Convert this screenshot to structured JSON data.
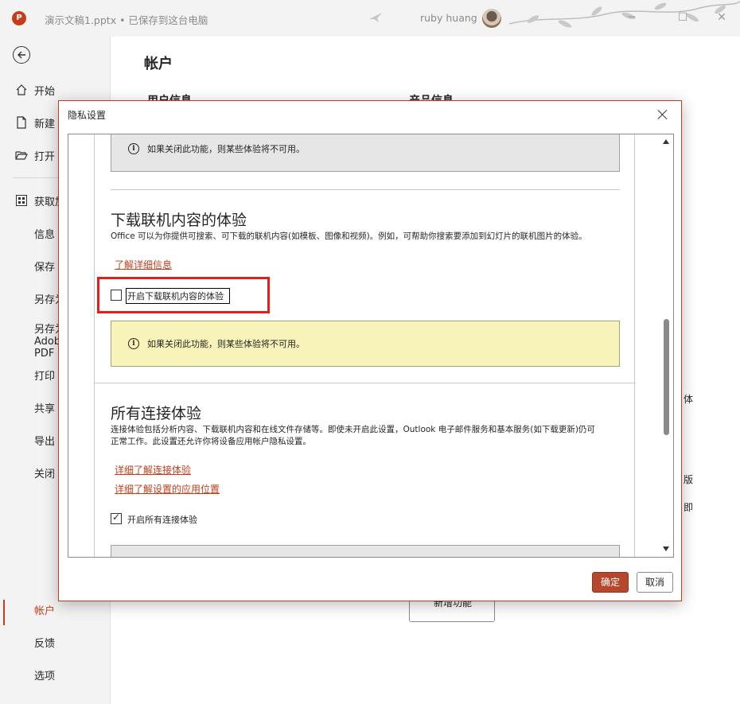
{
  "titlebar": {
    "app_logo": "P",
    "document_title": "演示文稿1.pptx • 已保存到这台电脑",
    "user_name": "ruby huang",
    "minimize": "─",
    "restore": "☐",
    "close": "✕"
  },
  "sidebar": {
    "items": [
      {
        "label": "开始",
        "icon": "home-icon"
      },
      {
        "label": "新建",
        "icon": "new-document-icon"
      },
      {
        "label": "打开",
        "icon": "open-folder-icon"
      },
      {
        "label": "获取加载项",
        "icon": "addins-icon"
      },
      {
        "label": "信息"
      },
      {
        "label": "保存"
      },
      {
        "label": "另存为"
      },
      {
        "label": "另存为 Adobe PDF"
      },
      {
        "label": "打印"
      },
      {
        "label": "共享"
      },
      {
        "label": "导出"
      },
      {
        "label": "关闭"
      },
      {
        "label": "帐户",
        "active": true
      },
      {
        "label": "反馈"
      },
      {
        "label": "选项"
      }
    ]
  },
  "account_page": {
    "title": "帐户",
    "user_info_heading": "用户信息",
    "product_info_heading": "产品信息",
    "right_fragments": [
      "体",
      "版",
      "即"
    ],
    "whats_new_button": "新增功能"
  },
  "dialog": {
    "title": "隐私设置",
    "top_info_text": "如果关闭此功能，则某些体验将不可用。",
    "download_section": {
      "heading": "下载联机内容的体验",
      "description": "Office 可以为你提供可搜索、可下载的联机内容(如模板、图像和视频)。例如，可帮助你搜索要添加到幻灯片的联机图片的体验。",
      "learn_more_link": "了解详细信息",
      "checkbox_label": "开启下载联机内容的体验",
      "checkbox_checked": false,
      "info_text": "如果关闭此功能，则某些体验将不可用。"
    },
    "connected_section": {
      "heading": "所有连接体验",
      "description_line1": "连接体验包括分析内容、下载联机内容和在线文件存储等。即使未开启此设置，Outlook 电子邮件服务和基本服务(如下载更新)仍可",
      "description_line2": "正常工作。此设置还允许你将设备应用帐户隐私设置。",
      "link1": "详细了解连接体验",
      "link2": "详细了解设置的应用位置",
      "checkbox_label": "开启所有连接体验",
      "checkbox_checked": true
    },
    "ok_button": "确定",
    "cancel_button": "取消"
  },
  "colors": {
    "accent": "#c43e1c",
    "highlight_box": "#e81c1c",
    "info_yellow": "#f8f3b8",
    "info_gray": "#e6e6e6"
  }
}
